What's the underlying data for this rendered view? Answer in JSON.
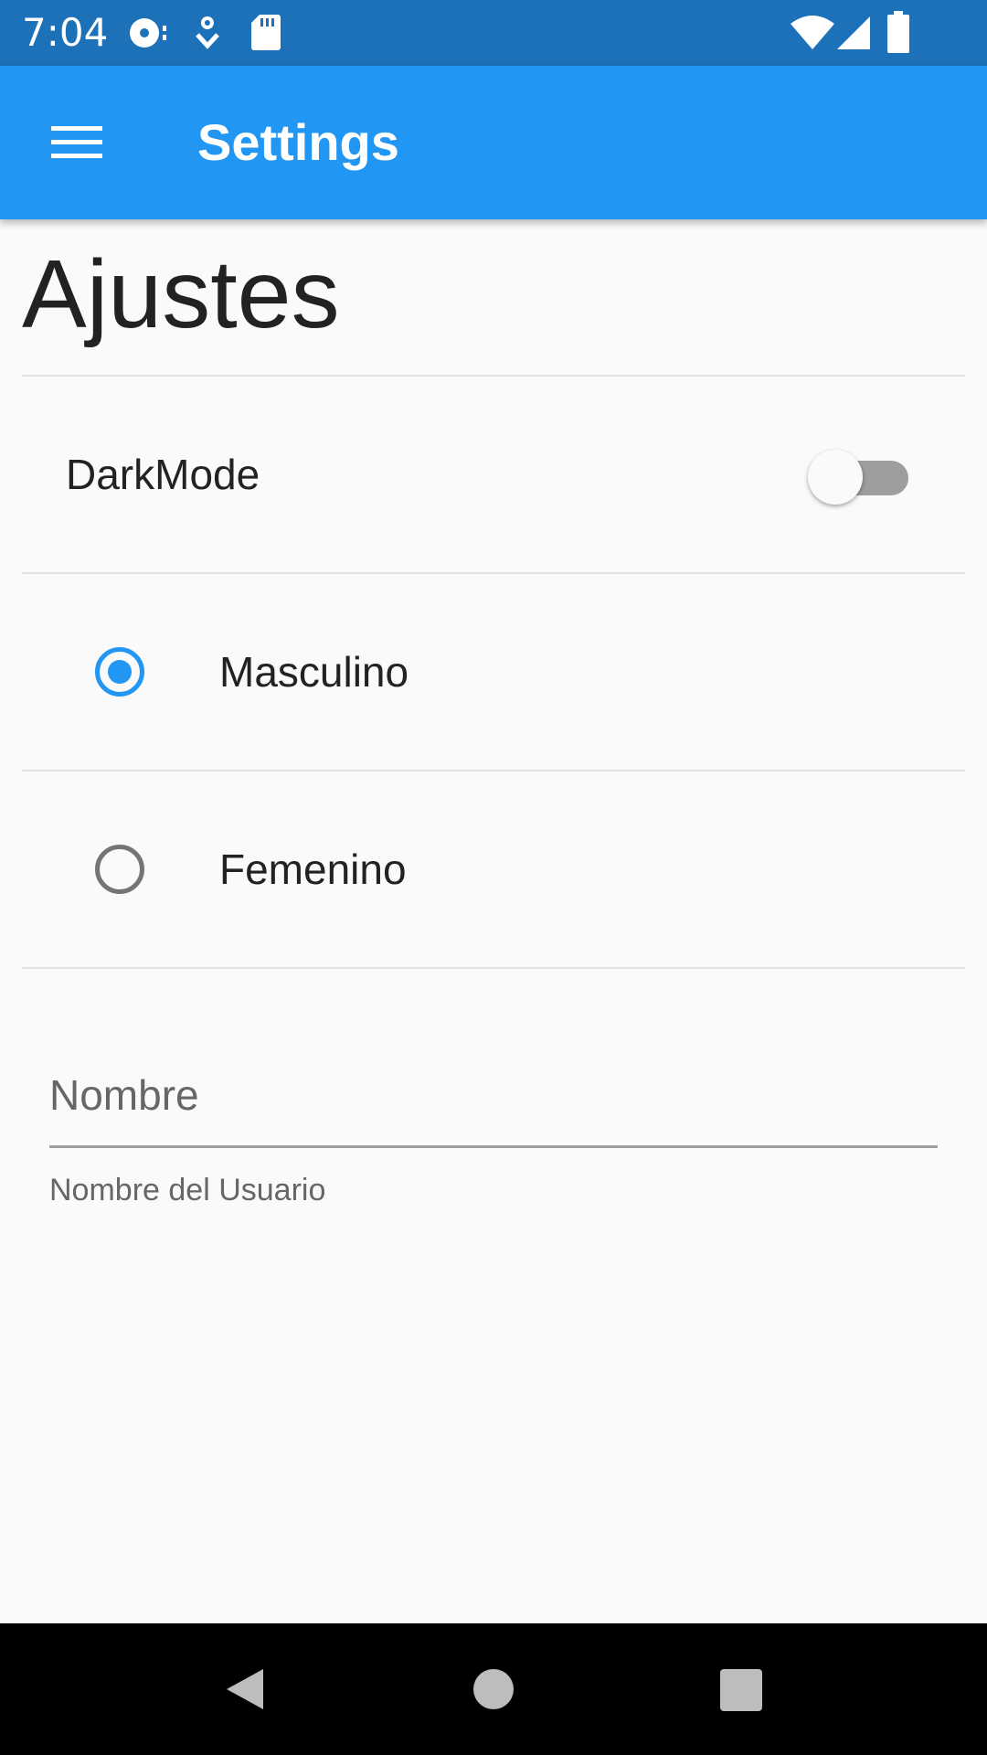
{
  "status_bar": {
    "time": "7:04",
    "left_icons": [
      "media-icon",
      "download-icon",
      "sd-card-icon"
    ],
    "right_icons": [
      "wifi-icon",
      "cell-signal-icon",
      "battery-icon"
    ],
    "background": "#1c71b8"
  },
  "app_bar": {
    "title": "Settings",
    "menu_icon": "hamburger-menu-icon",
    "background": "#2196f3"
  },
  "page": {
    "heading": "Ajustes"
  },
  "settings": {
    "dark_mode": {
      "label": "DarkMode",
      "enabled": false
    },
    "gender": {
      "options": [
        {
          "label": "Masculino",
          "selected": true
        },
        {
          "label": "Femenino",
          "selected": false
        }
      ],
      "accent": "#2196f3"
    },
    "name": {
      "placeholder": "Nombre",
      "value": "",
      "helper": "Nombre del Usuario"
    }
  },
  "nav_bar": {
    "buttons": [
      "back-icon",
      "home-icon",
      "recents-icon"
    ]
  }
}
